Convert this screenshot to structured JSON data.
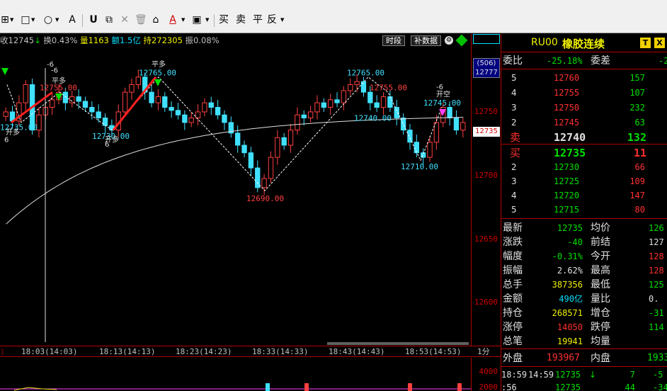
{
  "toolbar": {
    "items": [
      "⊞",
      "□",
      "○",
      "A",
      "U",
      "⧉",
      "✕",
      "🗑",
      "⌂",
      "A",
      "▣",
      "买",
      "卖",
      "平",
      "反"
    ]
  },
  "infobar": {
    "close_label": "收12745",
    "turnover_label": "换0.43%",
    "vol_label": "量1163",
    "amount_label": "额1.5亿",
    "hold_label": "持272305",
    "amp_label": "振0.08%",
    "btn_period": "时段",
    "btn_fill": "补数据"
  },
  "chart_data": {
    "type": "candlestick",
    "price_ticks": [
      "12750",
      "12700",
      "12650",
      "12600"
    ],
    "right_markers": [
      "(506)",
      "12777",
      "12735"
    ],
    "annotations": [
      {
        "text": "12735.00"
      },
      {
        "text": "12755.00"
      },
      {
        "text": "12730.00"
      },
      {
        "text": "12765.00"
      },
      {
        "text": "12690.00"
      },
      {
        "text": "12740.00"
      },
      {
        "text": "12765.00"
      },
      {
        "text": "12755.00"
      },
      {
        "text": "12710.00"
      },
      {
        "text": "12745.00"
      }
    ],
    "signals": [
      "开多",
      "平多",
      "平多",
      "开多",
      "开空",
      "-6",
      "6",
      "-6",
      "6",
      "-6"
    ],
    "time_labels": [
      "18:03(14:03)",
      "18:13(14:13)",
      "18:23(14:23)",
      "18:33(14:33)",
      "18:43(14:43)",
      "18:53(14:53)",
      "1分"
    ],
    "sub_ticks": [
      "4000",
      "2000"
    ]
  },
  "panel": {
    "code": "RU00",
    "name": "橡胶连续",
    "badge_t": "T",
    "badge_x": "X",
    "weibi_label": "委比",
    "weibi_value": "-25.18%",
    "weicha_label": "委差",
    "weicha_value": "-2",
    "asks": [
      {
        "level": "5",
        "price": "12760",
        "vol": "157"
      },
      {
        "level": "4",
        "price": "12755",
        "vol": "107"
      },
      {
        "level": "3",
        "price": "12750",
        "vol": "232"
      },
      {
        "level": "2",
        "price": "12745",
        "vol": "63"
      },
      {
        "level": "卖",
        "price": "12740",
        "vol": "132"
      }
    ],
    "bids": [
      {
        "level": "买",
        "price": "12735",
        "vol": "11"
      },
      {
        "level": "2",
        "price": "12730",
        "vol": "66"
      },
      {
        "level": "3",
        "price": "12725",
        "vol": "109"
      },
      {
        "level": "4",
        "price": "12720",
        "vol": "147"
      },
      {
        "level": "5",
        "price": "12715",
        "vol": "80"
      }
    ],
    "stats": [
      {
        "l1": "最新",
        "v1": "12735",
        "l2": "均价",
        "v2": "126"
      },
      {
        "l1": "涨跌",
        "v1": "-40",
        "l2": "前结",
        "v2": "127"
      },
      {
        "l1": "幅度",
        "v1": "-0.31%",
        "l2": "今开",
        "v2": "128"
      },
      {
        "l1": "振幅",
        "v1": "2.62%",
        "l2": "最高",
        "v2": "128"
      },
      {
        "l1": "总手",
        "v1": "387356",
        "l2": "最低",
        "v2": "125"
      },
      {
        "l1": "金额",
        "v1": "490亿",
        "l2": "量比",
        "v2": "0."
      },
      {
        "l1": "持仓",
        "v1": "268571",
        "l2": "增仓",
        "v2": "-31"
      },
      {
        "l1": "涨停",
        "v1": "14050",
        "l2": "跌停",
        "v2": "114"
      },
      {
        "l1": "总笔",
        "v1": "19941",
        "l2": "均量",
        "v2": ""
      }
    ],
    "outer_label": "外盘",
    "outer_value": "193967",
    "inner_label": "内盘",
    "inner_value": "1933",
    "ticks": [
      {
        "time": "18:59",
        "sub": "14:59",
        "price": "12735",
        "arrow": "↓",
        "vol": "7",
        "chg": "-5"
      },
      {
        "time": ":56",
        "sub": "",
        "price": "12735",
        "arrow": "",
        "vol": "44",
        "chg": "-34"
      }
    ]
  }
}
